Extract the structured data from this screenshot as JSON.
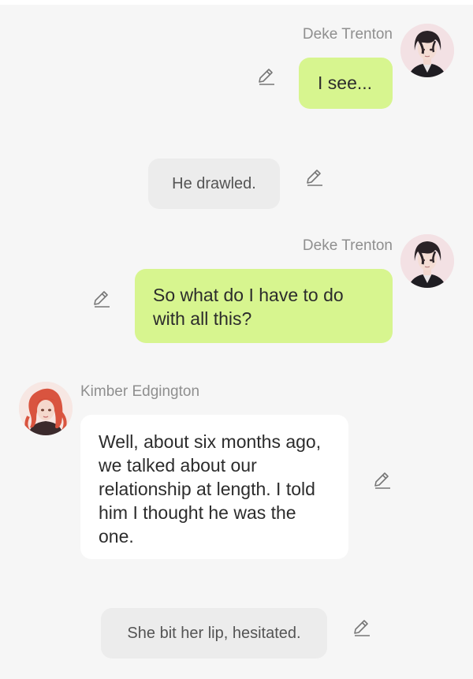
{
  "messages": [
    {
      "type": "speech",
      "speaker": "Deke Trenton",
      "text": "I see..."
    },
    {
      "type": "narration",
      "text": "He drawled."
    },
    {
      "type": "speech",
      "speaker": "Deke Trenton",
      "text": "So what do I have to do with all this?"
    },
    {
      "type": "speech",
      "speaker": "Kimber Edgington",
      "text": "Well, about six months ago, we talked about our relationship at length. I told him I thought he was the one."
    },
    {
      "type": "narration",
      "text": "She bit her lip, hesitated."
    }
  ],
  "colors": {
    "user_bubble": "#d7f58f",
    "other_bubble": "#ffffff",
    "narration_bubble": "#ececec",
    "background": "#f6f6f6",
    "name_text": "#8f8f8f"
  },
  "icons": {
    "edit": "pencil-icon",
    "avatar_deke": "avatar-deke-trenton",
    "avatar_kimber": "avatar-kimber-edgington"
  }
}
